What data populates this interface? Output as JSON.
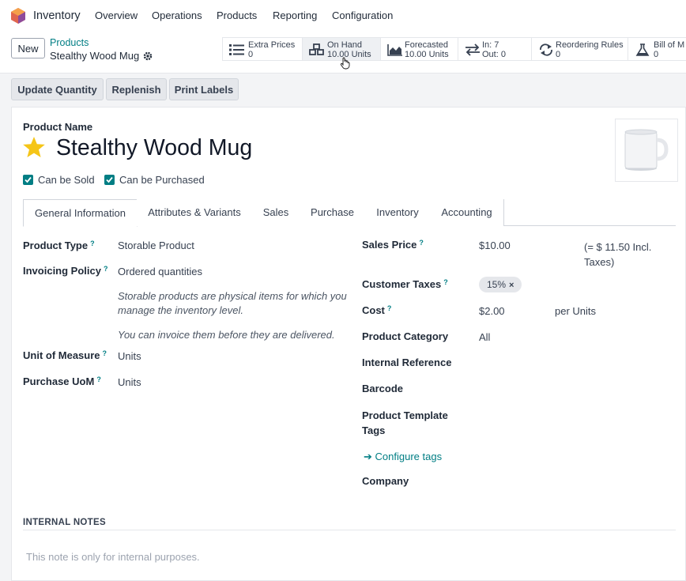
{
  "topbar": {
    "app_name": "Inventory",
    "menu": [
      "Overview",
      "Operations",
      "Products",
      "Reporting",
      "Configuration"
    ]
  },
  "control": {
    "new_label": "New",
    "breadcrumb_parent": "Products",
    "breadcrumb_current": "Stealthy Wood Mug",
    "smart_buttons": [
      {
        "icon": "list-icon",
        "line1": "Extra Prices",
        "line2": "0"
      },
      {
        "icon": "cubes-icon",
        "line1": "On Hand",
        "line2": "10.00 Units"
      },
      {
        "icon": "area-chart-icon",
        "line1": "Forecasted",
        "line2": "10.00 Units"
      },
      {
        "icon": "exchange-icon",
        "line1": "In: 7",
        "line2": "Out: 0"
      },
      {
        "icon": "refresh-icon",
        "line1": "Reordering Rules",
        "line2": "0"
      },
      {
        "icon": "flask-icon",
        "line1": "Bill of M",
        "line2": "0"
      }
    ]
  },
  "actions": [
    "Update Quantity",
    "Replenish",
    "Print Labels"
  ],
  "product": {
    "name_label": "Product Name",
    "name": "Stealthy Wood Mug",
    "can_be_sold": "Can be Sold",
    "can_be_purchased": "Can be Purchased"
  },
  "tabs": [
    "General Information",
    "Attributes & Variants",
    "Sales",
    "Purchase",
    "Inventory",
    "Accounting"
  ],
  "left_fields": {
    "product_type": {
      "label": "Product Type",
      "help": "?",
      "value": "Storable Product"
    },
    "invoicing_policy": {
      "label": "Invoicing Policy",
      "help": "?",
      "value": "Ordered quantities"
    },
    "note_storable": "Storable products are physical items for which you manage the inventory level.",
    "note_invoice": "You can invoice them before they are delivered.",
    "uom": {
      "label": "Unit of Measure",
      "help": "?",
      "value": "Units"
    },
    "purchase_uom": {
      "label": "Purchase UoM",
      "help": "?",
      "value": "Units"
    }
  },
  "right_fields": {
    "sales_price": {
      "label": "Sales Price",
      "help": "?",
      "value": "$10.00",
      "incl": "(= $ 11.50 Incl. Taxes)"
    },
    "customer_taxes": {
      "label": "Customer Taxes",
      "help": "?",
      "tag": "15%",
      "tag_remove": "×"
    },
    "cost": {
      "label": "Cost",
      "help": "?",
      "value": "$2.00",
      "unit": "per Units"
    },
    "category": {
      "label": "Product Category",
      "value": "All"
    },
    "internal_ref": {
      "label": "Internal Reference"
    },
    "barcode": {
      "label": "Barcode"
    },
    "template_tags": {
      "label": "Product Template Tags"
    },
    "configure_tags": "Configure tags",
    "company": {
      "label": "Company"
    }
  },
  "notes": {
    "title": "INTERNAL NOTES",
    "placeholder": "This note is only for internal purposes."
  },
  "colors": {
    "accent": "#017e84",
    "star": "#f5c518"
  }
}
